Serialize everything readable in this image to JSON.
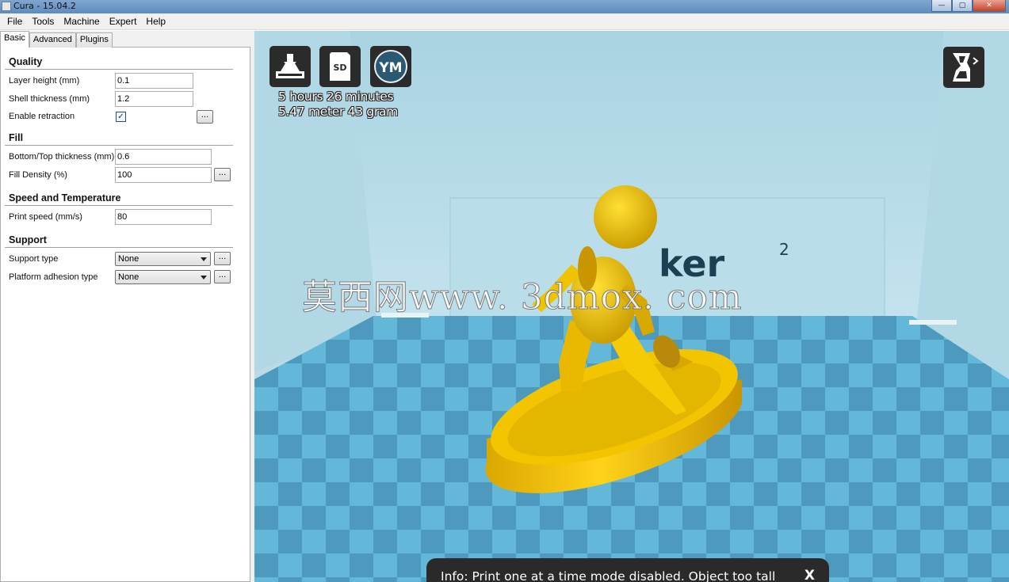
{
  "window": {
    "title": "Cura - 15.04.2",
    "minimize": "—",
    "maximize": "▢",
    "close": "✕"
  },
  "menu": [
    "File",
    "Tools",
    "Machine",
    "Expert",
    "Help"
  ],
  "tabs": [
    "Basic",
    "Advanced",
    "Plugins"
  ],
  "settings": {
    "quality": {
      "title": "Quality",
      "layer_height_label": "Layer height (mm)",
      "layer_height": "0.1",
      "shell_thickness_label": "Shell thickness (mm)",
      "shell_thickness": "1.2",
      "retraction_label": "Enable retraction",
      "retraction_checked": true
    },
    "fill": {
      "title": "Fill",
      "bottom_top_label": "Bottom/Top thickness (mm)",
      "bottom_top": "0.6",
      "density_label": "Fill Density (%)",
      "density": "100"
    },
    "speed": {
      "title": "Speed and Temperature",
      "print_speed_label": "Print speed (mm/s)",
      "print_speed": "80"
    },
    "support": {
      "title": "Support",
      "support_type_label": "Support type",
      "support_type": "None",
      "adhesion_label": "Platform adhesion type",
      "adhesion": "None"
    },
    "more_button": "..."
  },
  "viewport": {
    "toolbar_icons": [
      "load-model-icon",
      "save-sd-icon",
      "youmagine-icon",
      "view-mode-icon"
    ],
    "sd_label": "SD",
    "ym_label": "YM",
    "print_time": "5 hours 26 minutes",
    "print_material": "5.47 meter 43 gram",
    "backdrop_text": "ker",
    "backdrop_super": "2",
    "watermark": "莫西网www. 3dmox. com",
    "info_message": "Info: Print one at a time mode disabled. Object too tall",
    "info_close": "X",
    "colors": {
      "bed_light": "#56b1d6",
      "bed_dark": "#3f92b9",
      "model": "#f2c500",
      "background": "#b8dbe6"
    }
  }
}
